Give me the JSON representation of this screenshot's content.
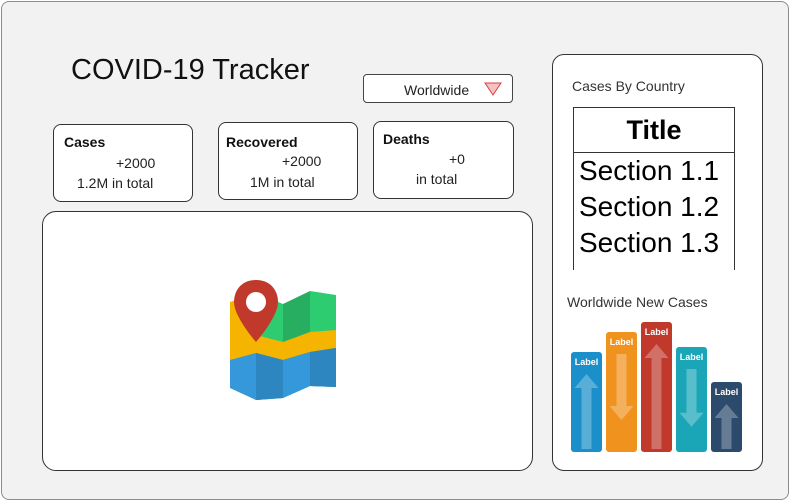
{
  "app": {
    "title": "COVID-19 Tracker"
  },
  "region_select": {
    "value": "Worldwide",
    "icon": "triangle-down-icon",
    "icon_color": "#f4b6b6"
  },
  "stats": {
    "cases": {
      "title": "Cases",
      "delta": "+2000",
      "total": "1.2M in total"
    },
    "recovered": {
      "title": "Recovered",
      "delta": "+2000",
      "total": "1M in total"
    },
    "deaths": {
      "title": "Deaths",
      "delta": "+0",
      "total": "in total"
    }
  },
  "map": {
    "icon": "map-pin-icon"
  },
  "sidebar": {
    "table_heading": "Cases By Country",
    "table": {
      "title": "Title",
      "rows": [
        "Section 1.1",
        "Section 1.2",
        "Section 1.3"
      ]
    },
    "chart_heading": "Worldwide New Cases"
  },
  "chart_data": {
    "type": "bar",
    "title": "Worldwide New Cases",
    "categories": [
      "Label",
      "Label",
      "Label",
      "Label",
      "Label"
    ],
    "values": [
      100,
      120,
      130,
      105,
      70
    ],
    "colors": [
      "#1a8fc9",
      "#f0921e",
      "#c0392b",
      "#1aa6b7",
      "#2c4a6b"
    ],
    "arrows": [
      "up",
      "down",
      "up",
      "down",
      "up"
    ]
  }
}
